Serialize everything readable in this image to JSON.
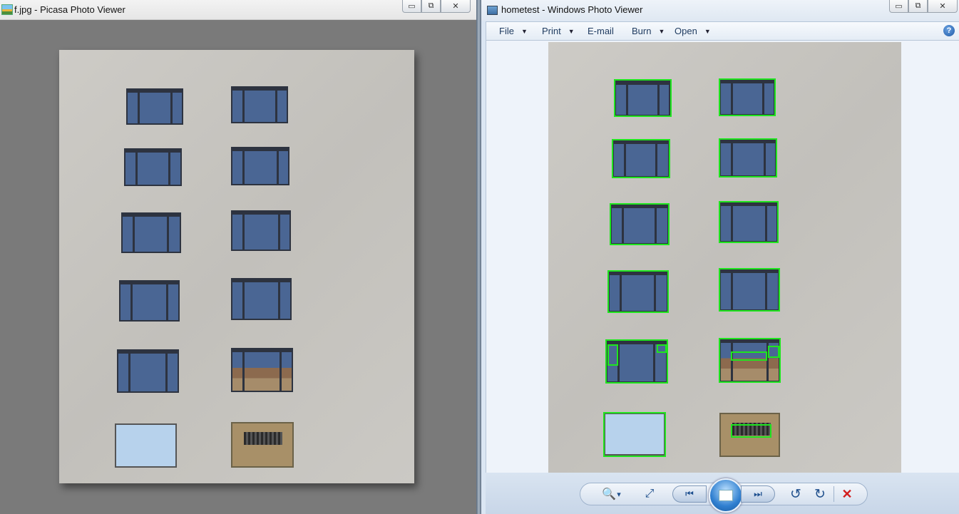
{
  "picasa": {
    "title": "f.jpg - Picasa Photo Viewer",
    "caption_buttons": {
      "minimize": "▭",
      "maximize": "⧉",
      "close": "✕"
    }
  },
  "photo_viewer": {
    "title": "hometest - Windows Photo Viewer",
    "caption_buttons": {
      "minimize": "▭",
      "maximize": "⧉",
      "close": "✕"
    },
    "menu": [
      {
        "label": "File",
        "dropdown": true
      },
      {
        "label": "Print",
        "dropdown": true
      },
      {
        "label": "E-mail",
        "dropdown": false
      },
      {
        "label": "Burn",
        "dropdown": true
      },
      {
        "label": "Open",
        "dropdown": true
      }
    ],
    "help_label": "?",
    "toolbar": {
      "zoom": "🔍",
      "zoom_caret": "▾",
      "fit": "⤢",
      "previous": "⏮",
      "next": "⏭",
      "rotate_ccw": "↺",
      "rotate_cw": "↻",
      "delete": "✕"
    }
  },
  "colors": {
    "detection_box": "#1fe51f",
    "wall": "#c8c6c1",
    "glass": "#4a6694"
  },
  "icons": [
    "picasa-app-icon",
    "photo-viewer-app-icon",
    "help-icon",
    "zoom-icon",
    "fit-to-window-icon",
    "previous-icon",
    "slideshow-icon",
    "next-icon",
    "rotate-ccw-icon",
    "rotate-cw-icon",
    "delete-icon"
  ]
}
